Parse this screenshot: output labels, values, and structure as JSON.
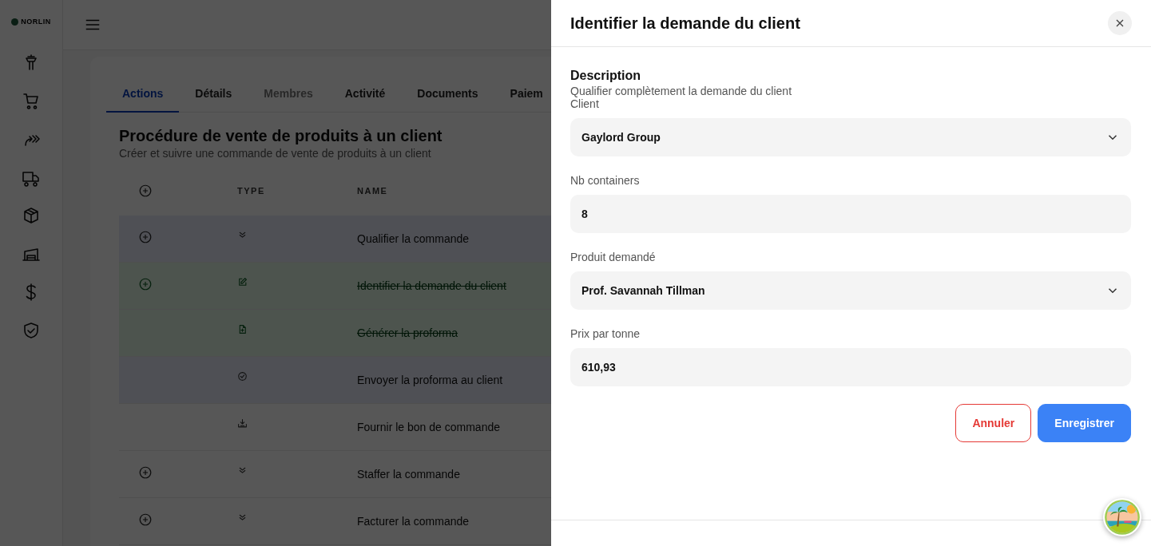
{
  "logo": {
    "text": "NORLIN"
  },
  "sidebar": {
    "items": [
      {
        "kind": "tower"
      },
      {
        "kind": "cart"
      },
      {
        "kind": "forward"
      },
      {
        "kind": "truck"
      },
      {
        "kind": "box"
      },
      {
        "kind": "warehouse"
      },
      {
        "kind": "dollar"
      },
      {
        "kind": "shield"
      }
    ]
  },
  "tabs": [
    {
      "label": "Actions",
      "selected": true,
      "disabled": false
    },
    {
      "label": "Détails",
      "selected": false,
      "disabled": false
    },
    {
      "label": "Membres",
      "selected": false,
      "disabled": true
    },
    {
      "label": "Activité",
      "selected": false,
      "disabled": false
    },
    {
      "label": "Documents",
      "selected": false,
      "disabled": false
    },
    {
      "label": "Paiem",
      "selected": false,
      "disabled": false
    }
  ],
  "procedure": {
    "title": "Procédure de vente de produits à un client",
    "subtitle": "Créer et suivre une commande de vente de produits à un client"
  },
  "table": {
    "columns": [
      "TYPE",
      "NAME"
    ],
    "rows": [
      {
        "kind": "stage",
        "name": "Qualifier la commande",
        "highlighted": true,
        "done": false,
        "addable": true
      },
      {
        "kind": "edit",
        "name": "Identifier la demande du client",
        "highlighted": false,
        "done": true,
        "addable": true
      },
      {
        "kind": "file",
        "name": "Générer la proforma",
        "highlighted": false,
        "done": true,
        "addable": false
      },
      {
        "kind": "check",
        "name": "Envoyer la proforma au client",
        "highlighted": true,
        "done": false,
        "addable": false
      },
      {
        "kind": "download",
        "name": "Fournir le bon de commande",
        "highlighted": false,
        "done": false,
        "addable": false
      },
      {
        "kind": "stage",
        "name": "Staffer la commande",
        "highlighted": false,
        "done": false,
        "addable": true
      },
      {
        "kind": "stage",
        "name": "Facturer la commande",
        "highlighted": false,
        "done": false,
        "addable": true
      }
    ]
  },
  "panel": {
    "title": "Identifier la demande du client",
    "section": "Description",
    "hint": "Qualifier complètement la demande du client",
    "fields": [
      {
        "kind": "select",
        "label": "Client",
        "value": "Gaylord Group"
      },
      {
        "kind": "text",
        "label": "Nb containers",
        "value": "8"
      },
      {
        "kind": "select",
        "label": "Produit demandé",
        "value": "Prof. Savannah Tillman"
      },
      {
        "kind": "text",
        "label": "Prix par tonne",
        "value": "610,93"
      }
    ],
    "buttons": [
      {
        "kind": "cancel",
        "label": "Annuler"
      },
      {
        "kind": "save",
        "label": "Enregistrer"
      }
    ]
  }
}
